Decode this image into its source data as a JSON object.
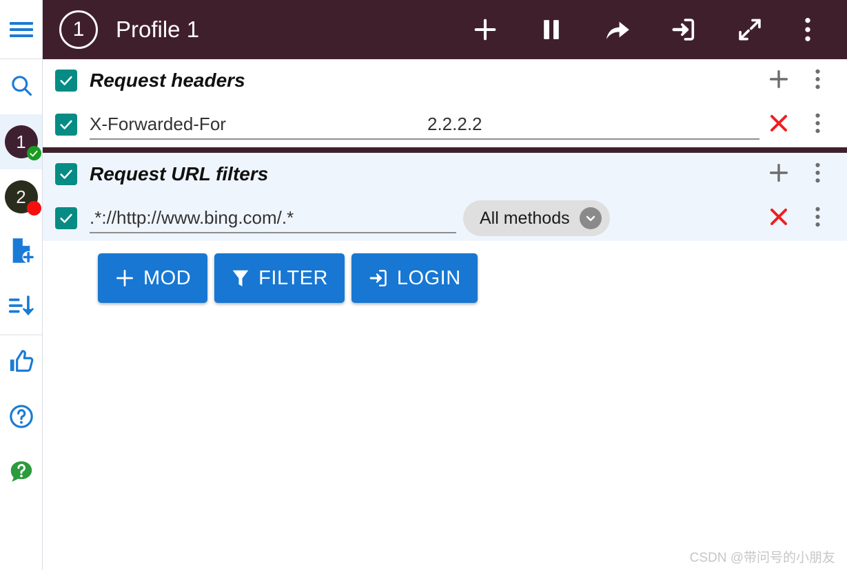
{
  "sidebar": {
    "menu_icon": "hamburger-menu-icon",
    "items": [
      {
        "name": "search",
        "icon": "search-icon",
        "label": ""
      },
      {
        "name": "profile-1",
        "icon": "profile-badge",
        "label": "1",
        "status": "active",
        "selected": true
      },
      {
        "name": "profile-2",
        "icon": "profile-badge",
        "label": "2",
        "status": "paused",
        "selected": false
      },
      {
        "name": "new-profile",
        "icon": "file-add-icon",
        "label": ""
      },
      {
        "name": "sort-list",
        "icon": "sort-descending-icon",
        "label": ""
      },
      {
        "name": "rate",
        "icon": "thumbs-up-icon",
        "label": ""
      },
      {
        "name": "help",
        "icon": "help-circle-icon",
        "label": ""
      },
      {
        "name": "faq",
        "icon": "chat-question-icon",
        "label": ""
      }
    ],
    "colors": {
      "accent": "#1b7ad6",
      "profile1_badge": "#3f2030",
      "profile2_badge": "#2a2d1c",
      "status_active": "#1a9b21",
      "status_paused": "#f50f0f",
      "selected_row": "#eaf2fb"
    }
  },
  "titlebar": {
    "profile_number": "1",
    "title": "Profile 1",
    "background": "#401f2c",
    "actions": [
      {
        "name": "add",
        "icon": "plus-icon"
      },
      {
        "name": "pause",
        "icon": "pause-icon"
      },
      {
        "name": "share",
        "icon": "share-arrow-icon"
      },
      {
        "name": "login",
        "icon": "login-icon"
      },
      {
        "name": "expand",
        "icon": "expand-diagonal-icon"
      },
      {
        "name": "more",
        "icon": "more-vertical-icon"
      }
    ]
  },
  "sections": [
    {
      "name": "request-headers",
      "title": "Request headers",
      "enabled": true,
      "add_icon": "plus-icon",
      "more_icon": "more-vertical-icon",
      "rows": [
        {
          "enabled": true,
          "name_value": "X-Forwarded-For",
          "value": "2.2.2.2",
          "delete_icon": "close-x-icon",
          "more_icon": "more-vertical-icon"
        }
      ]
    },
    {
      "name": "request-url-filters",
      "title": "Request URL filters",
      "enabled": true,
      "add_icon": "plus-icon",
      "more_icon": "more-vertical-icon",
      "rows": [
        {
          "enabled": true,
          "url_pattern": ".*://http://www.bing.com/.*",
          "method": "All methods",
          "method_caret": "chevron-down-icon",
          "delete_icon": "close-x-icon",
          "more_icon": "more-vertical-icon"
        }
      ]
    }
  ],
  "buttons": [
    {
      "name": "add-mod",
      "label": "MOD",
      "icon": "plus-icon"
    },
    {
      "name": "add-filter",
      "label": "FILTER",
      "icon": "funnel-icon"
    },
    {
      "name": "add-login",
      "label": "LOGIN",
      "icon": "login-icon"
    }
  ],
  "watermark": "CSDN @带问号的小朋友",
  "theme": {
    "primary_button": "#1877d2",
    "checkbox": "#068c84",
    "delete": "#ef1f1f",
    "section_blue": "#eff5fc"
  }
}
